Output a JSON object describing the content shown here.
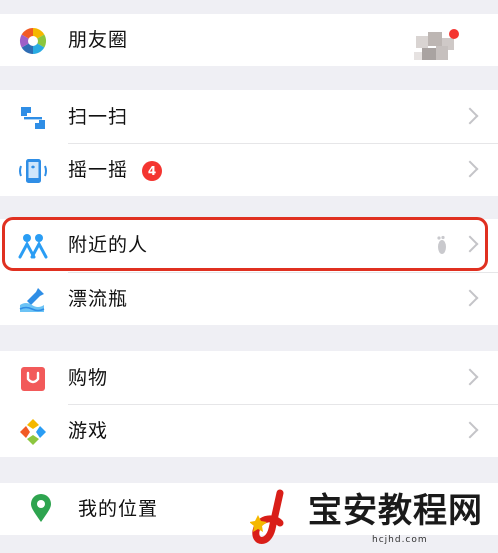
{
  "menu": {
    "moments": {
      "label": "朋友圈",
      "icon": "moments-aperture-icon"
    },
    "scan": {
      "label": "扫一扫",
      "icon": "scan-icon"
    },
    "shake": {
      "label": "摇一摇",
      "icon": "shake-phone-icon",
      "badge": "4"
    },
    "nearby": {
      "label": "附近的人",
      "icon": "people-nearby-icon",
      "trailing_icon": "footprint-icon"
    },
    "bottle": {
      "label": "漂流瓶",
      "icon": "drift-bottle-icon"
    },
    "shopping": {
      "label": "购物",
      "icon": "shopping-bag-icon"
    },
    "games": {
      "label": "游戏",
      "icon": "games-diamond-icon"
    },
    "location": {
      "label": "我的位置",
      "icon": "location-pin-icon"
    }
  },
  "watermark": {
    "title": "宝安教程网",
    "subtitle": "hcjhd.com"
  },
  "colors": {
    "background": "#efeff4",
    "highlight": "#e03020",
    "badge": "#f43530",
    "scan_blue": "#2f8ee6",
    "nearby_blue": "#2a9df4",
    "shopping_red": "#f25a5a",
    "location_green": "#2ea44f"
  }
}
